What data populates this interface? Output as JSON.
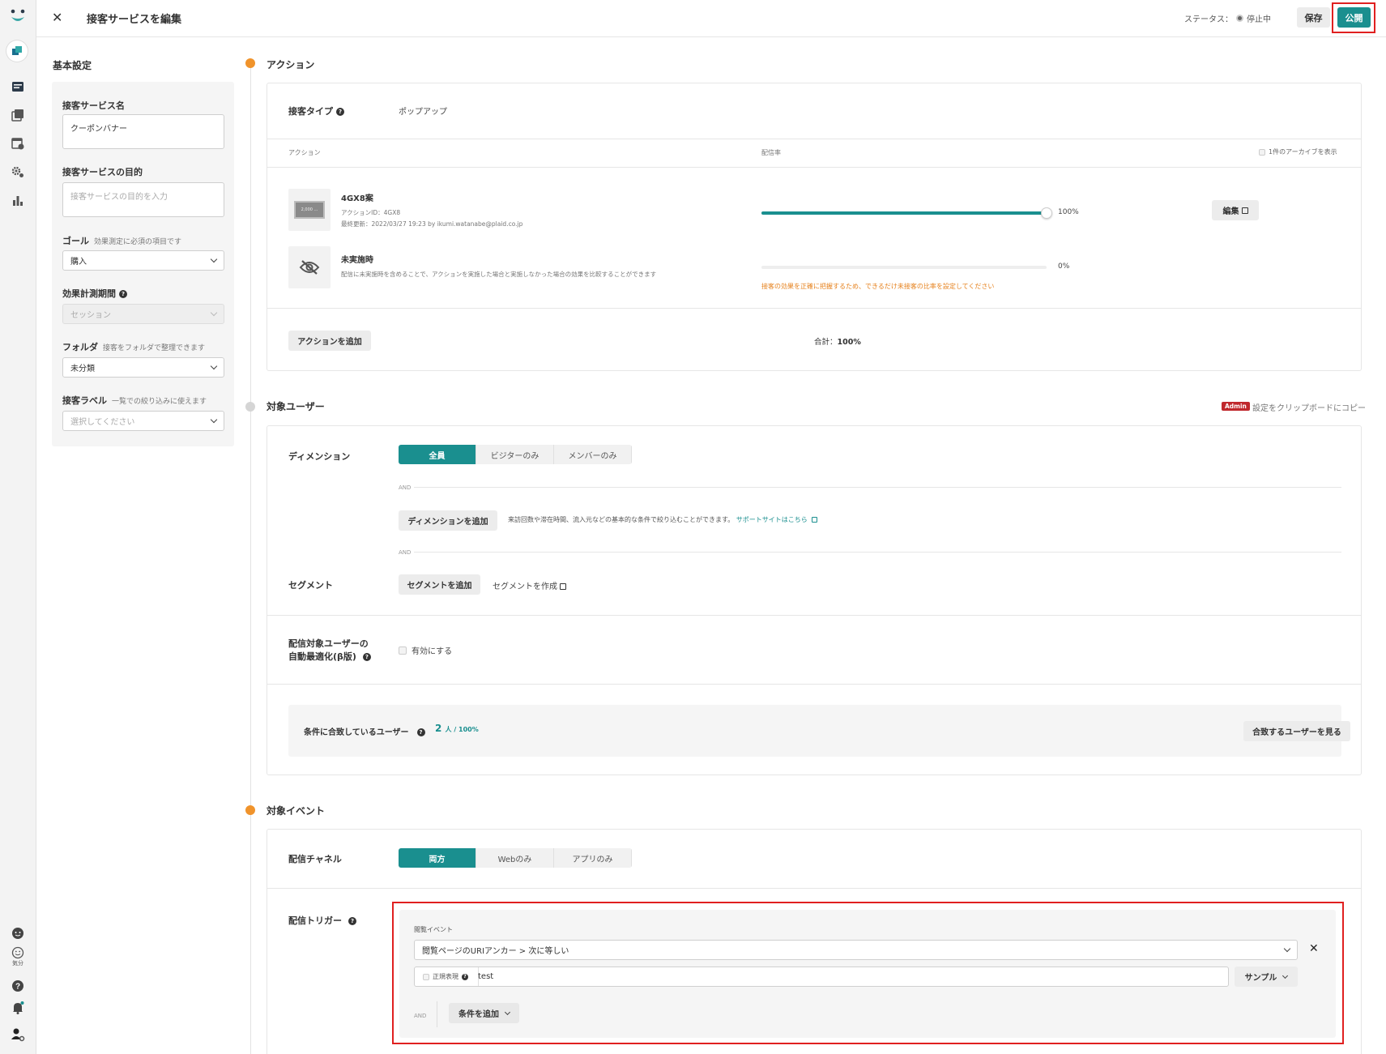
{
  "header": {
    "title": "接客サービスを編集",
    "status_label": "ステータス：",
    "status_value": "停止中",
    "save_label": "保存",
    "publish_label": "公開"
  },
  "rail": {
    "mood_label": "気分"
  },
  "basic": {
    "heading": "基本設定",
    "name_label": "接客サービス名",
    "name_value": "クーポンバナー",
    "purpose_label": "接客サービスの目的",
    "purpose_placeholder": "接客サービスの目的を入力",
    "goal_label": "ゴール",
    "goal_sub": "効果測定に必須の項目です",
    "goal_value": "購入",
    "period_label": "効果計測期間",
    "period_value": "セッション",
    "folder_label": "フォルダ",
    "folder_sub": "接客をフォルダで整理できます",
    "folder_value": "未分類",
    "tag_label": "接客ラベル",
    "tag_sub": "一覧での絞り込みに使えます",
    "tag_placeholder": "選択してください"
  },
  "action": {
    "heading": "アクション",
    "type_label": "接客タイプ",
    "type_value": "ポップアップ",
    "col_action": "アクション",
    "col_rate": "配信率",
    "archive_label": "1件のアーカイブを表示",
    "item1_name": "4GX8案",
    "item1_id": "アクションID：4GX8",
    "item1_updated": "最終更新：2022/03/27 19:23 by ikumi.watanabe@plaid.co.jp",
    "item1_rate": "100%",
    "item1_rate_value": 100,
    "thumb_text": "2,000 ...",
    "more_label": "···",
    "edit_label": "編集",
    "item2_name": "未実施時",
    "item2_desc": "配信に未実施時を含めることで、アクションを実施した場合と実施しなかった場合の効果を比較することができます",
    "item2_rate": "0%",
    "item2_warning": "接客の効果を正確に把握するため、できるだけ未接客の比率を設定してください",
    "add_action_label": "アクションを追加",
    "total_label": "合計：",
    "total_value": "100%"
  },
  "target_users": {
    "heading": "対象ユーザー",
    "admin_badge": "Admin",
    "copy_label": "設定をクリップボードにコピー",
    "dimension_label": "ディメンション",
    "seg_options": [
      "全員",
      "ビジターのみ",
      "メンバーのみ"
    ],
    "and_label": "AND",
    "add_dimension_label": "ディメンションを追加",
    "dimension_hint": "来訪回数や滞在時間、流入元などの基本的な条件で絞り込むことができます。",
    "support_link": "サポートサイトはこちら",
    "segment_label": "セグメント",
    "add_segment_label": "セグメントを追加",
    "create_segment_label": "セグメントを作成",
    "optimize_label_1": "配信対象ユーザーの",
    "optimize_label_2": "自動最適化(β版)",
    "enable_label": "有効にする",
    "match_label": "条件に合致しているユーザー",
    "match_count": "2",
    "match_unit": "人 / 100%",
    "view_users_label": "合致するユーザーを見る"
  },
  "target_events": {
    "heading": "対象イベント",
    "channel_label": "配信チャネル",
    "channel_options": [
      "両方",
      "Webのみ",
      "アプリのみ"
    ],
    "trigger_label": "配信トリガー",
    "browse_event_label": "閲覧イベント",
    "condition_value": "閲覧ページのURIアンカー > 次に等しい",
    "regex_label": "正規表現",
    "test_value": "test",
    "sample_label": "サンプル",
    "and_label": "AND",
    "add_condition_label": "条件を追加"
  },
  "colors": {
    "accent": "#1a8f8f",
    "orange": "#f0932b",
    "warning": "#e6821e",
    "highlight": "#e02020"
  }
}
